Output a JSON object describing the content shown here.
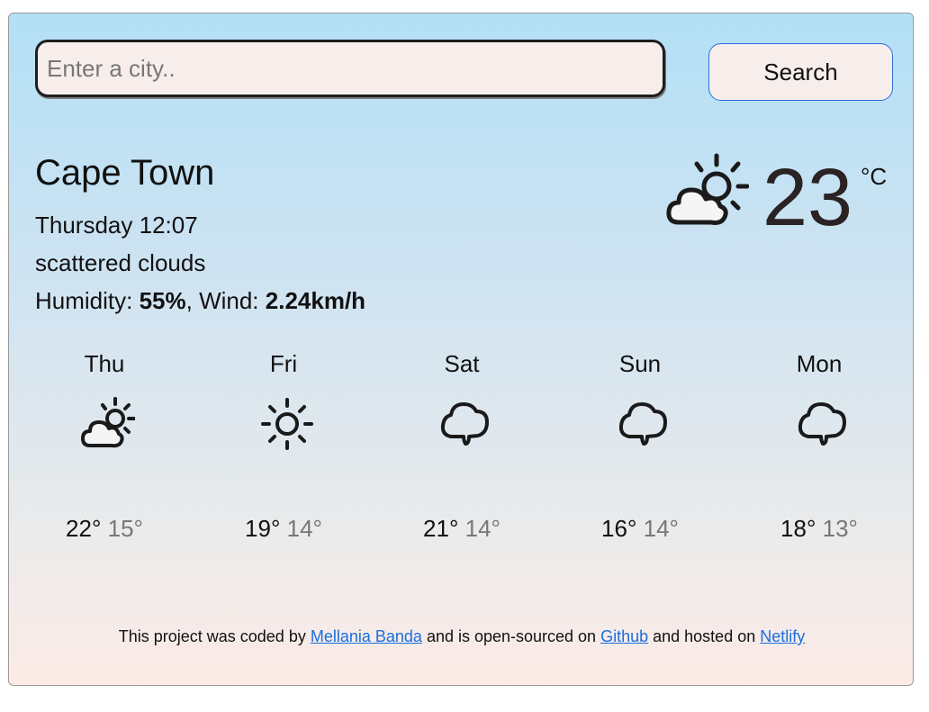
{
  "search": {
    "placeholder": "Enter a city..",
    "button_label": "Search"
  },
  "current": {
    "city": "Cape Town",
    "datetime": "Thursday 12:07",
    "description": "scattered clouds",
    "humidity_label": "Humidity: ",
    "humidity_value": "55%",
    "wind_label": ", Wind: ",
    "wind_value": "2.24km/h",
    "temperature": "23",
    "unit": "°C",
    "icon": "sun-behind-cloud-icon"
  },
  "forecast": [
    {
      "day": "Thu",
      "icon": "sun-behind-cloud-icon",
      "max": "22°",
      "min": "15°"
    },
    {
      "day": "Fri",
      "icon": "sun-icon",
      "max": "19°",
      "min": "14°"
    },
    {
      "day": "Sat",
      "icon": "cloud-icon",
      "max": "21°",
      "min": "14°"
    },
    {
      "day": "Sun",
      "icon": "cloud-icon",
      "max": "16°",
      "min": "14°"
    },
    {
      "day": "Mon",
      "icon": "cloud-icon",
      "max": "18°",
      "min": "13°"
    }
  ],
  "footer": {
    "text1": "This project was coded by ",
    "author": "Mellania Banda",
    "text2": " and is open-sourced on ",
    "github": "Github",
    "text3": " and hosted on ",
    "netlify": "Netlify"
  },
  "colors": {
    "link": "#1a6ee0",
    "button_border": "#2d6fd9",
    "min_temp": "#777777"
  }
}
